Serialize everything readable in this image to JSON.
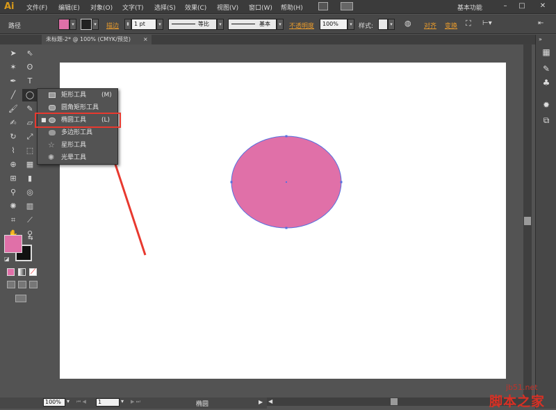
{
  "app": {
    "logo": "Ai",
    "workspace": "基本功能"
  },
  "menu": [
    "文件(F)",
    "编辑(E)",
    "对象(O)",
    "文字(T)",
    "选择(S)",
    "效果(C)",
    "视图(V)",
    "窗口(W)",
    "帮助(H)"
  ],
  "control": {
    "path_label": "路径",
    "stroke_link": "描边",
    "stroke_weight": "1 pt",
    "profile_uniform": "等比",
    "brush_basic": "基本",
    "opacity_link": "不透明度",
    "opacity_value": "100%",
    "style_label": "样式:",
    "align_link": "对齐",
    "transform_link": "变换"
  },
  "document": {
    "tab": "未标题-2* @ 100% (CMYK/预览)"
  },
  "flyout": {
    "items": [
      {
        "label": "矩形工具",
        "shortcut": "(M)",
        "icon": "rectangle-icon"
      },
      {
        "label": "圆角矩形工具",
        "shortcut": "",
        "icon": "rounded-rectangle-icon"
      },
      {
        "label": "椭圆工具",
        "shortcut": "(L)",
        "icon": "ellipse-icon",
        "selected": true
      },
      {
        "label": "多边形工具",
        "shortcut": "",
        "icon": "polygon-icon"
      },
      {
        "label": "星形工具",
        "shortcut": "",
        "icon": "star-icon"
      },
      {
        "label": "光晕工具",
        "shortcut": "",
        "icon": "flare-icon"
      }
    ]
  },
  "status": {
    "zoom": "100%",
    "artboard_num": "1",
    "selection_info": "椭圆"
  },
  "colors": {
    "fill": "#e070a8",
    "highlight": "#e8392f",
    "accent_link": "#e79a2c"
  },
  "watermark": {
    "site": "jb51.net",
    "name": "脚本之家"
  }
}
